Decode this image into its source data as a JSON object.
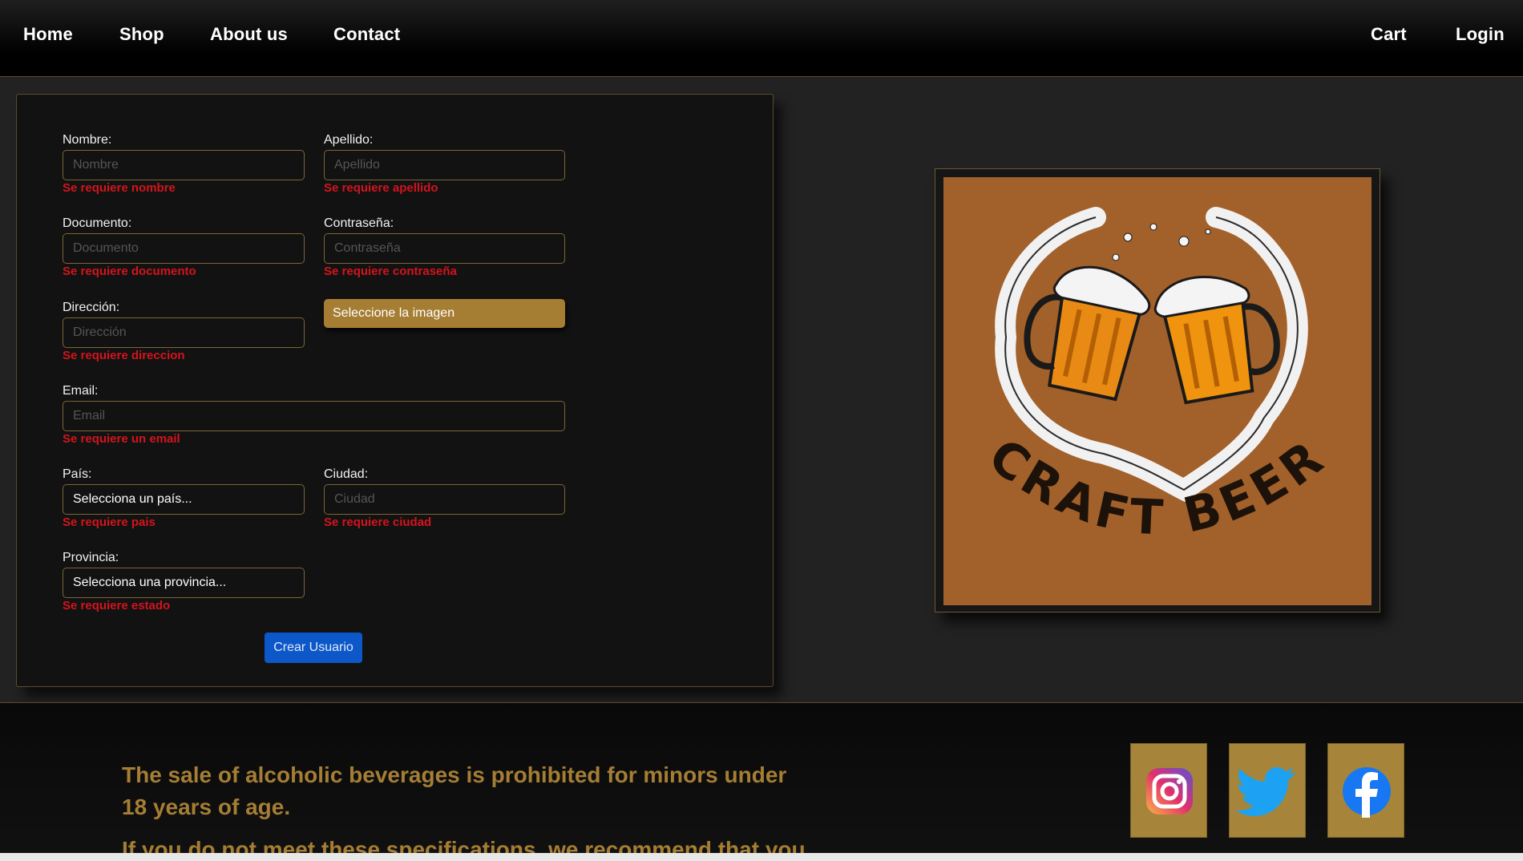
{
  "nav": {
    "home": "Home",
    "shop": "Shop",
    "about": "About us",
    "contact": "Contact",
    "cart": "Cart",
    "login": "Login"
  },
  "form": {
    "nombre": {
      "label": "Nombre:",
      "placeholder": "Nombre",
      "error": "Se requiere nombre"
    },
    "apellido": {
      "label": "Apellido:",
      "placeholder": "Apellido",
      "error": "Se requiere apellido"
    },
    "documento": {
      "label": "Documento:",
      "placeholder": "Documento",
      "error": "Se requiere documento"
    },
    "contrasena": {
      "label": "Contraseña:",
      "placeholder": "Contraseña",
      "error": "Se requiere contraseña"
    },
    "direccion": {
      "label": "Dirección:",
      "placeholder": "Dirección",
      "error": "Se requiere direccion"
    },
    "imagen_button": "Seleccione la imagen",
    "email": {
      "label": "Email:",
      "placeholder": "Email",
      "error": "Se requiere un email"
    },
    "pais": {
      "label": "País:",
      "value": "Selecciona un país...",
      "error": "Se requiere pais"
    },
    "ciudad": {
      "label": "Ciudad:",
      "placeholder": "Ciudad",
      "error": "Se requiere ciudad"
    },
    "provincia": {
      "label": "Provincia:",
      "value": "Selecciona una provincia...",
      "error": "Se requiere estado"
    },
    "submit": "Crear Usuario"
  },
  "logo": {
    "text": "CRAFT BEER"
  },
  "footer": {
    "line1": "The sale of alcoholic beverages is prohibited for minors under",
    "line2": "18 years of age.",
    "line3": "If you do not meet these specifications, we recommend that you"
  },
  "social": [
    "instagram-icon",
    "twitter-icon",
    "facebook-icon"
  ],
  "colors": {
    "gold": "#a57e34",
    "error": "#d4141c",
    "primary": "#0d58c9",
    "logo_bg": "#a2602a"
  }
}
